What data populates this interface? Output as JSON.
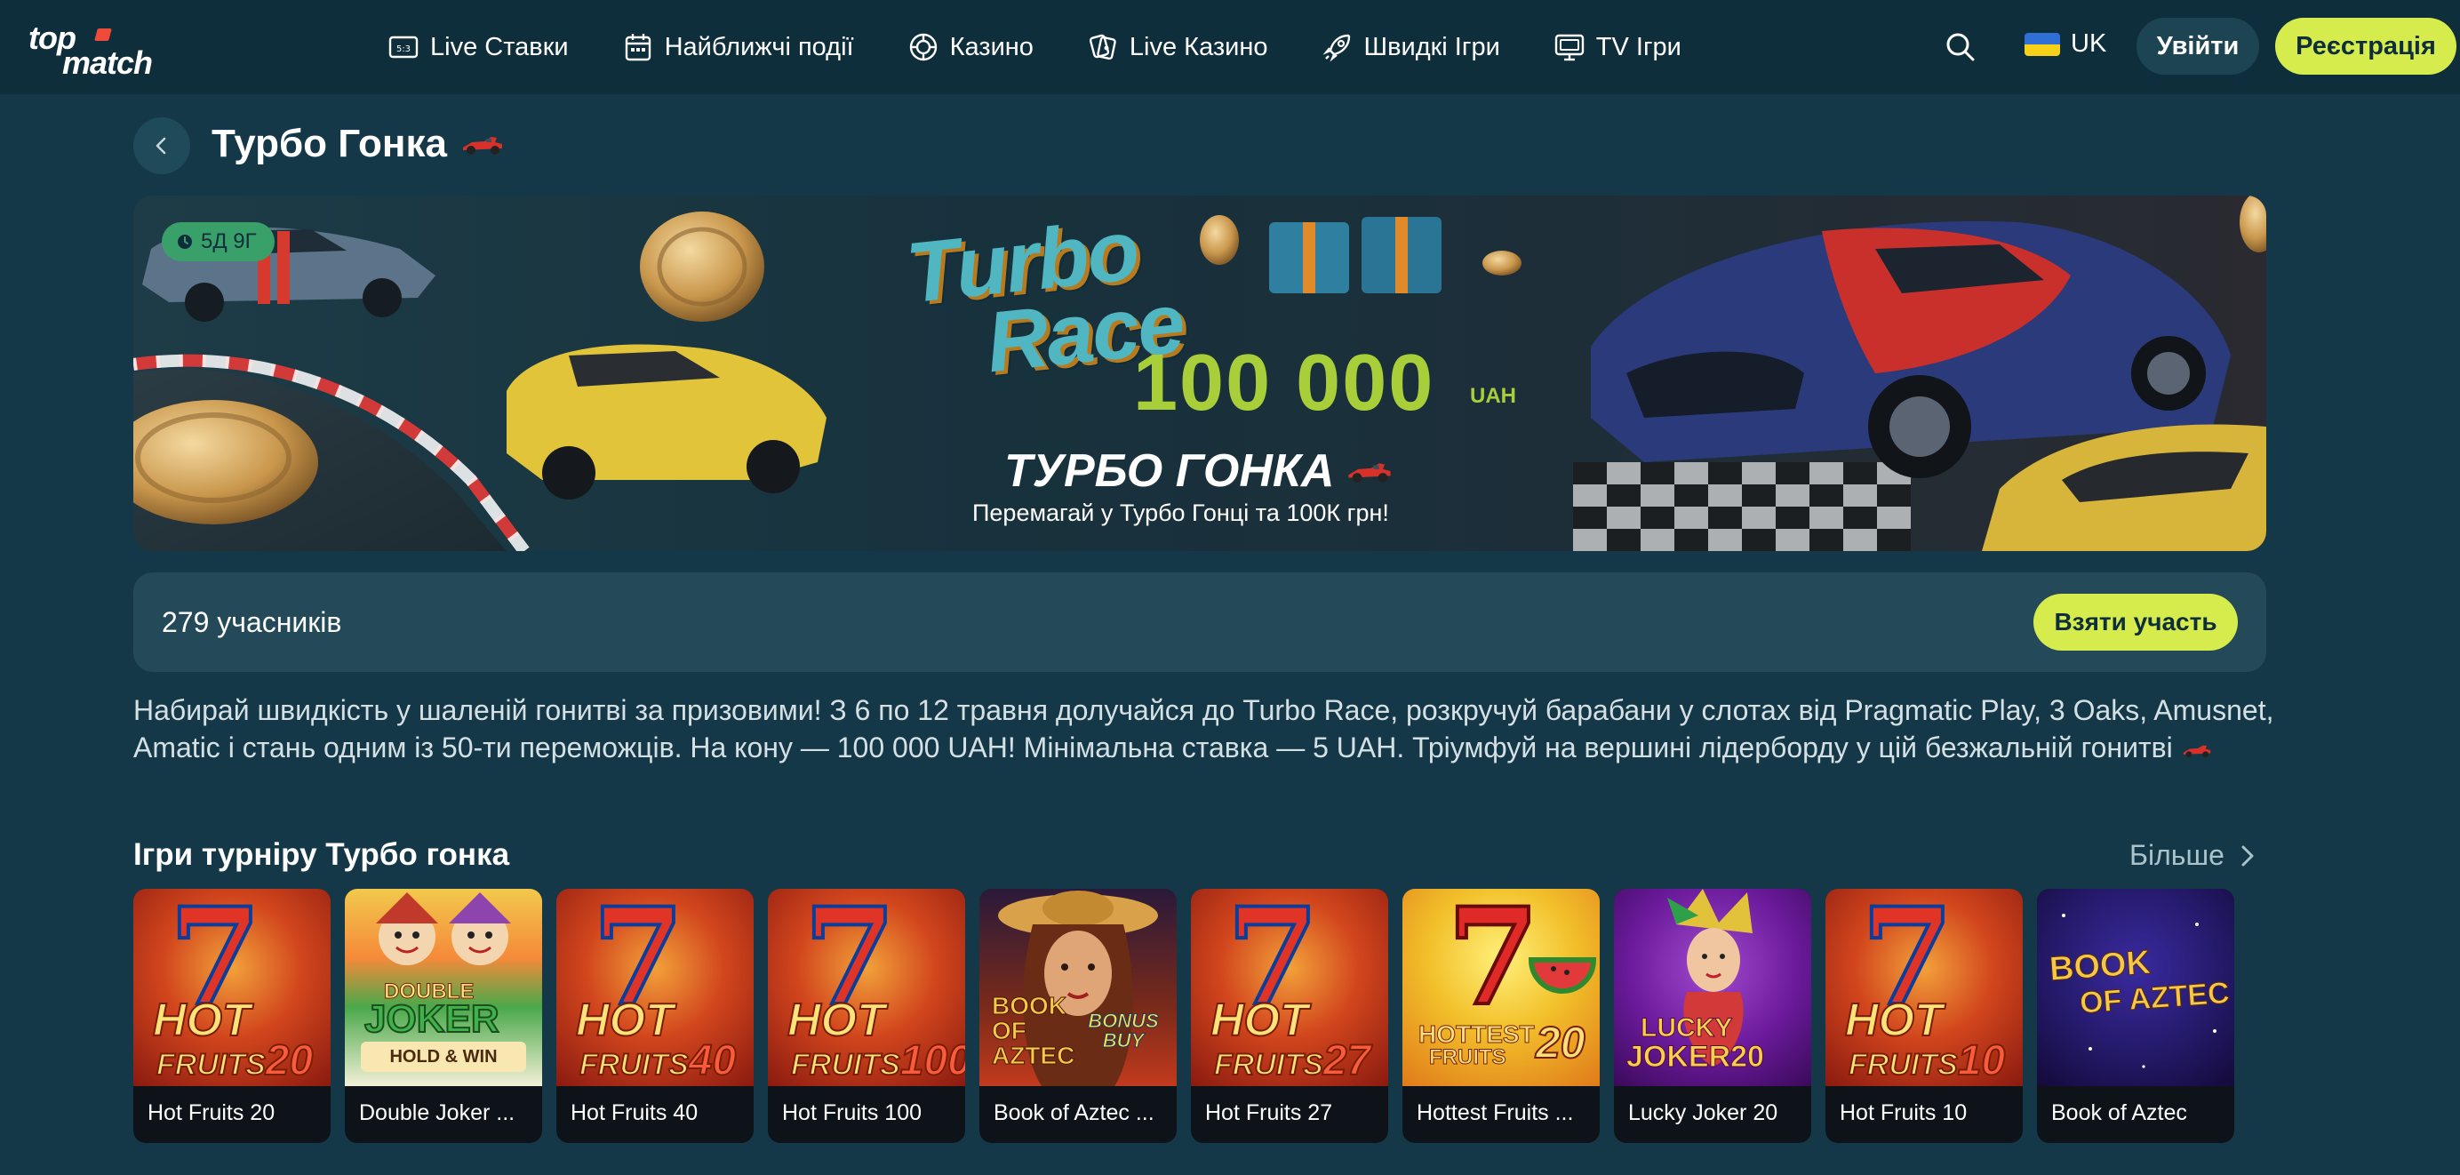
{
  "header": {
    "logo_line1": "top",
    "logo_line2": "match",
    "nav": [
      {
        "label": "Live Ставки",
        "icon": "live-scoreboard-icon"
      },
      {
        "label": "Найближчі події",
        "icon": "calendar-icon"
      },
      {
        "label": "Казино",
        "icon": "casino-chip-icon"
      },
      {
        "label": "Live Казино",
        "icon": "live-cards-icon"
      },
      {
        "label": "Швидкі Ігри",
        "icon": "rocket-icon"
      },
      {
        "label": "TV Ігри",
        "icon": "tv-icon"
      }
    ],
    "language": "UK",
    "login_label": "Увійти",
    "register_label": "Реєстрація"
  },
  "page": {
    "title": "Турбо Гонка"
  },
  "banner": {
    "timer": "5Д 9Г",
    "logo_line1": "Turbo",
    "logo_line2": "Race",
    "amount": "100 000",
    "currency": "UAH",
    "heading": "ТУРБО ГОНКА",
    "subtitle": "Перемагай у Турбо Гонці та 100К грн!"
  },
  "participants": {
    "count_text": "279 учасників",
    "join_label": "Взяти участь"
  },
  "description": "Набирай швидкість у шаленій гонитві за призовими! З 6 по 12 травня долучайся до Turbo Race, розкручуй барабани у слотах від Pragmatic Play, 3 Oaks, Amusnet, Amatic і стань одним із 50-ти переможців. На кону — 100 000 UAH! Мінімальна ставка — 5 UAH. Тріумфуй на вершині лідерборду у цій безжальній гонитві",
  "games_section": {
    "title": "Ігри турніру Турбо гонка",
    "more_label": "Більше",
    "games": [
      {
        "name": "Hot Fruits 20",
        "art_line1": "HOT",
        "art_line2": "FRUITS",
        "art_num": "20",
        "style": "hot"
      },
      {
        "name": "Double Joker ...",
        "art_line1": "DOUBLE",
        "art_line2": "JOKER",
        "art_num": "HOLD & WIN",
        "style": "joker"
      },
      {
        "name": "Hot Fruits 40",
        "art_line1": "HOT",
        "art_line2": "FRUITS",
        "art_num": "40",
        "style": "hot"
      },
      {
        "name": "Hot Fruits 100",
        "art_line1": "HOT",
        "art_line2": "FRUITS",
        "art_num": "100",
        "style": "hot"
      },
      {
        "name": "Book of Aztec ...",
        "art_line1": "BOOK OF AZTEC",
        "art_line2": "BONUS BUY",
        "art_num": "",
        "style": "aztec-lady"
      },
      {
        "name": "Hot Fruits 27",
        "art_line1": "HOT",
        "art_line2": "FRUITS",
        "art_num": "27",
        "style": "hot"
      },
      {
        "name": "Hottest Fruits ...",
        "art_line1": "HOTTEST",
        "art_line2": "FRUITS",
        "art_num": "20",
        "style": "hottest"
      },
      {
        "name": "Lucky Joker 20",
        "art_line1": "LUCKY",
        "art_line2": "JOKER",
        "art_num": "20",
        "style": "lucky"
      },
      {
        "name": "Hot Fruits 10",
        "art_line1": "HOT",
        "art_line2": "FRUITS",
        "art_num": "10",
        "style": "hot"
      },
      {
        "name": "Book of Aztec",
        "art_line1": "BOOK",
        "art_line2": "OF AZTEC",
        "art_num": "",
        "style": "aztec"
      }
    ]
  },
  "colors": {
    "background": "#143847",
    "header": "#0e2e3b",
    "accent": "#d6ec4c",
    "timer_badge": "#3aa06a"
  }
}
